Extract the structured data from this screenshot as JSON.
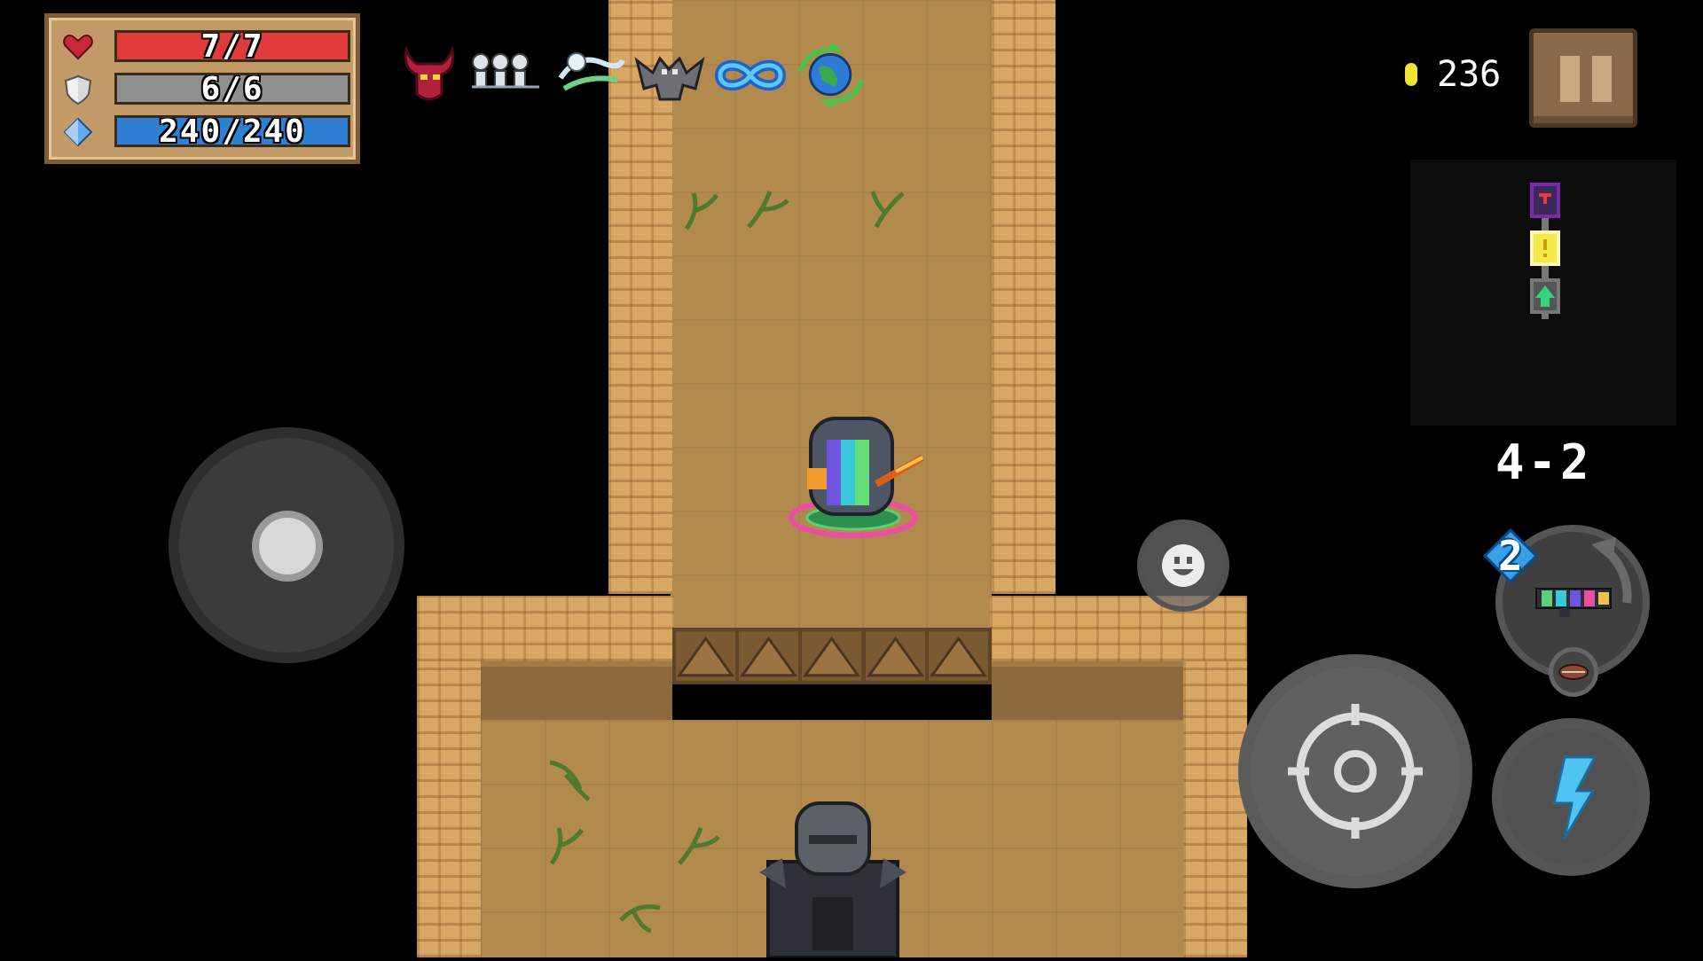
{
  "hud": {
    "health": {
      "current": 7,
      "max": 7,
      "text": "7/7",
      "color": "#e03a3a"
    },
    "armor": {
      "current": 6,
      "max": 6,
      "text": "6/6",
      "color": "#8f8f8f"
    },
    "energy": {
      "current": 240,
      "max": 240,
      "text": "240/240",
      "color": "#2f7fd2"
    }
  },
  "buffs": [
    {
      "icon": "demon-horns-buff-icon"
    },
    {
      "icon": "skeleton-squad-buff-icon"
    },
    {
      "icon": "ghost-wind-buff-icon"
    },
    {
      "icon": "gargoyle-buff-icon"
    },
    {
      "icon": "infinity-buff-icon"
    },
    {
      "icon": "globe-buff-icon"
    }
  ],
  "currency": {
    "icon": "gold-coin-icon",
    "coins": "236"
  },
  "level": {
    "text": "4-2"
  },
  "weapon": {
    "energy_cost": "2",
    "primary": "rainbow-gun-icon",
    "secondary": "bug-weapon-icon"
  },
  "controls": {
    "joystick": "movement-joystick",
    "fire": "crosshair-icon",
    "skill": "lightning-icon",
    "emote": "smiley-icon",
    "pause": "pause-icon"
  },
  "minimap": {
    "rooms": [
      {
        "type": "boss-room",
        "color": "#7a2aa8"
      },
      {
        "type": "event-room",
        "color": "#f4e84a"
      },
      {
        "type": "start-room",
        "color": "#36d47a"
      }
    ]
  },
  "colors": {
    "sand": "#b38a4e",
    "wall": "#d8a763",
    "hud_frame": "#c29a68"
  }
}
